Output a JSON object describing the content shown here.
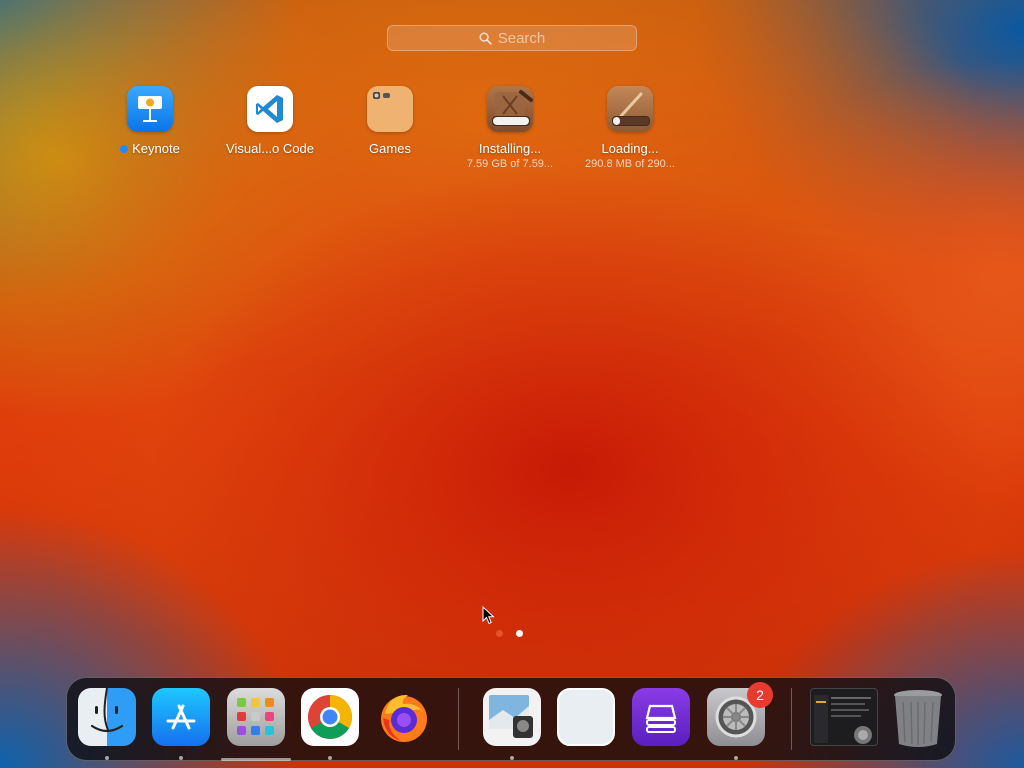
{
  "search": {
    "placeholder": "Search"
  },
  "apps": [
    {
      "name": "Keynote",
      "icon": "keynote-icon",
      "new": true
    },
    {
      "name": "Visual...o Code",
      "icon": "vscode-icon"
    },
    {
      "name": "Games",
      "icon": "games-folder-icon"
    },
    {
      "name": "Installing...",
      "status": "7.59 GB of 7.59...",
      "icon": "xcode-installing-icon",
      "progress": 0.99
    },
    {
      "name": "Loading...",
      "status": "290.8 MB of 290...",
      "icon": "app-loading-icon",
      "progress": 0.2
    }
  ],
  "pagination": {
    "pages": 2,
    "current": 2
  },
  "dock": {
    "items": [
      {
        "name": "Finder",
        "icon": "finder-icon",
        "running": true
      },
      {
        "name": "App Store",
        "icon": "app-store-icon",
        "running": true
      },
      {
        "name": "Launchpad",
        "icon": "launchpad-icon",
        "running": true
      },
      {
        "name": "Google Chrome",
        "icon": "chrome-icon",
        "running": true
      },
      {
        "name": "Firefox",
        "icon": "firefox-icon",
        "running": false
      },
      {
        "name": "Preview",
        "icon": "preview-icon",
        "running": true
      },
      {
        "name": "Blank App",
        "icon": "blank-app-icon",
        "running": false
      },
      {
        "name": "Purple App",
        "icon": "purple-app-icon",
        "running": false
      },
      {
        "name": "System Settings",
        "icon": "system-settings-icon",
        "running": true,
        "badge": "2"
      },
      {
        "name": "Window Thumbnail",
        "icon": "window-thumbnail-icon",
        "running": false
      },
      {
        "name": "Trash",
        "icon": "trash-icon",
        "running": false
      }
    ]
  },
  "colors": {
    "page_dot_inactive": "#e2552a",
    "page_dot_active": "#ffffff",
    "badge": "#e93a30"
  }
}
